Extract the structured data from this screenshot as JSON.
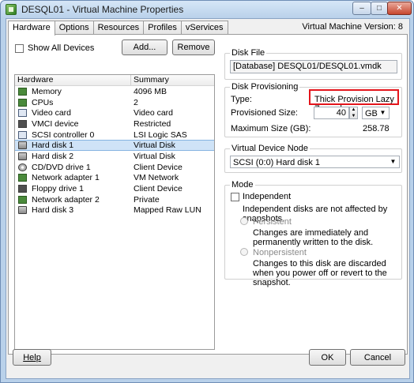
{
  "window": {
    "title": "DESQL01 - Virtual Machine Properties",
    "vm_version": "Virtual Machine Version: 8",
    "close_glyph": "✕",
    "minimize_glyph": "–",
    "maximize_glyph": "□"
  },
  "tabs": [
    "Hardware",
    "Options",
    "Resources",
    "Profiles",
    "vServices"
  ],
  "hardware_panel": {
    "show_all_devices": "Show All Devices",
    "add_button": "Add...",
    "remove_button": "Remove",
    "columns": [
      "Hardware",
      "Summary"
    ],
    "rows": [
      {
        "name": "Memory",
        "summary": "4096 MB",
        "icon": "memory-icon"
      },
      {
        "name": "CPUs",
        "summary": "2",
        "icon": "cpu-icon"
      },
      {
        "name": "Video card",
        "summary": "Video card",
        "icon": "monitor-icon"
      },
      {
        "name": "VMCI device",
        "summary": "Restricted",
        "icon": "vmci-icon"
      },
      {
        "name": "SCSI controller 0",
        "summary": "LSI Logic SAS",
        "icon": "scsi-controller-icon"
      },
      {
        "name": "Hard disk 1",
        "summary": "Virtual Disk",
        "icon": "hard-disk-icon"
      },
      {
        "name": "Hard disk 2",
        "summary": "Virtual Disk",
        "icon": "hard-disk-icon"
      },
      {
        "name": "CD/DVD drive 1",
        "summary": "Client Device",
        "icon": "cd-drive-icon"
      },
      {
        "name": "Network adapter 1",
        "summary": "VM Network",
        "icon": "network-adapter-icon"
      },
      {
        "name": "Floppy drive 1",
        "summary": "Client Device",
        "icon": "floppy-icon"
      },
      {
        "name": "Network adapter 2",
        "summary": "Private",
        "icon": "network-adapter-icon"
      },
      {
        "name": "Hard disk 3",
        "summary": "Mapped Raw LUN",
        "icon": "hard-disk-icon"
      }
    ],
    "selected_index": 5
  },
  "disk_file": {
    "title": "Disk File",
    "path": "[Database] DESQL01/DESQL01.vmdk"
  },
  "disk_provisioning": {
    "title": "Disk Provisioning",
    "type_label": "Type:",
    "type_value": "Thick Provision Lazy Zeroed",
    "provisioned_label": "Provisioned Size:",
    "provisioned_value": "40",
    "unit": "GB",
    "max_label": "Maximum Size (GB):",
    "max_value": "258.78"
  },
  "virtual_device_node": {
    "title": "Virtual Device Node",
    "selected": "SCSI (0:0) Hard disk 1"
  },
  "mode": {
    "title": "Mode",
    "independent_label": "Independent",
    "independent_desc": "Independent disks are not affected by snapshots.",
    "persistent_label": "Persistent",
    "persistent_desc": "Changes are immediately and permanently written to the disk.",
    "nonpersistent_label": "Nonpersistent",
    "nonpersistent_desc": "Changes to this disk are discarded when you power off or revert to the snapshot."
  },
  "footer": {
    "help": "Help",
    "ok": "OK",
    "cancel": "Cancel"
  },
  "colors": {
    "highlight_box": "#e4151c",
    "selection": "#cfe3f7",
    "window_frame": "#b9d1ea"
  }
}
